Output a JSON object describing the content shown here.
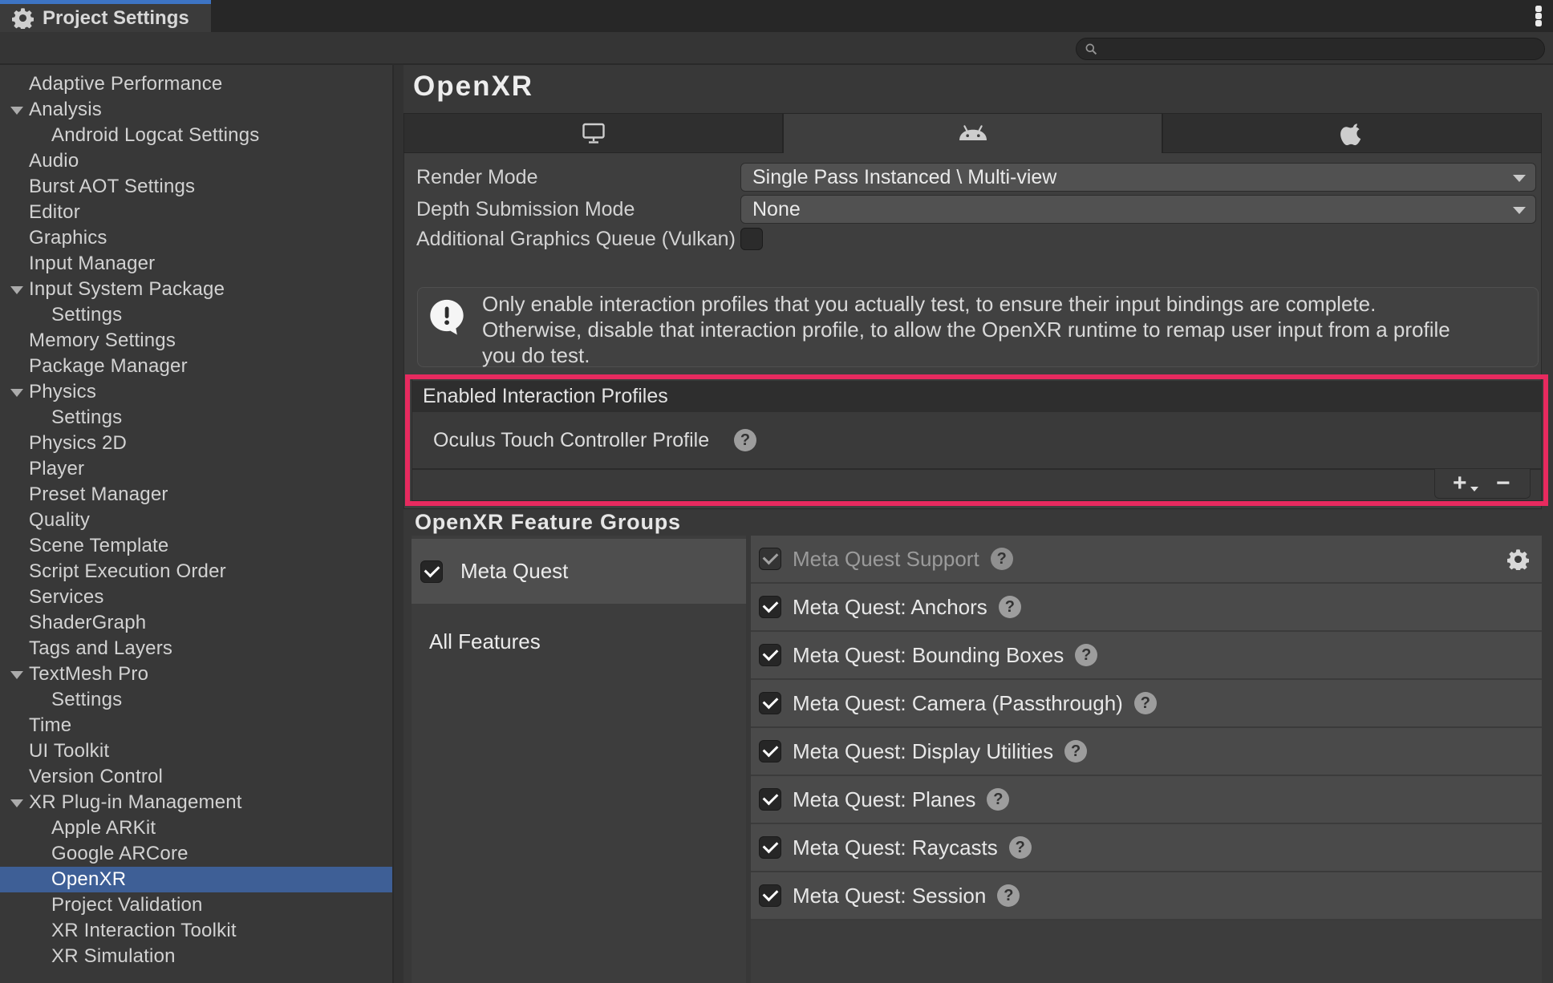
{
  "window": {
    "tab_title": "Project Settings",
    "search_value": ""
  },
  "sidebar": {
    "items": [
      {
        "label": "Adaptive Performance",
        "level": 0,
        "foldout": false,
        "selected": false
      },
      {
        "label": "Analysis",
        "level": 0,
        "foldout": true,
        "selected": false
      },
      {
        "label": "Android Logcat Settings",
        "level": 1,
        "foldout": false,
        "selected": false
      },
      {
        "label": "Audio",
        "level": 0,
        "foldout": false,
        "selected": false
      },
      {
        "label": "Burst AOT Settings",
        "level": 0,
        "foldout": false,
        "selected": false
      },
      {
        "label": "Editor",
        "level": 0,
        "foldout": false,
        "selected": false
      },
      {
        "label": "Graphics",
        "level": 0,
        "foldout": false,
        "selected": false
      },
      {
        "label": "Input Manager",
        "level": 0,
        "foldout": false,
        "selected": false
      },
      {
        "label": "Input System Package",
        "level": 0,
        "foldout": true,
        "selected": false
      },
      {
        "label": "Settings",
        "level": 1,
        "foldout": false,
        "selected": false
      },
      {
        "label": "Memory Settings",
        "level": 0,
        "foldout": false,
        "selected": false
      },
      {
        "label": "Package Manager",
        "level": 0,
        "foldout": false,
        "selected": false
      },
      {
        "label": "Physics",
        "level": 0,
        "foldout": true,
        "selected": false
      },
      {
        "label": "Settings",
        "level": 1,
        "foldout": false,
        "selected": false
      },
      {
        "label": "Physics 2D",
        "level": 0,
        "foldout": false,
        "selected": false
      },
      {
        "label": "Player",
        "level": 0,
        "foldout": false,
        "selected": false
      },
      {
        "label": "Preset Manager",
        "level": 0,
        "foldout": false,
        "selected": false
      },
      {
        "label": "Quality",
        "level": 0,
        "foldout": false,
        "selected": false
      },
      {
        "label": "Scene Template",
        "level": 0,
        "foldout": false,
        "selected": false
      },
      {
        "label": "Script Execution Order",
        "level": 0,
        "foldout": false,
        "selected": false
      },
      {
        "label": "Services",
        "level": 0,
        "foldout": false,
        "selected": false
      },
      {
        "label": "ShaderGraph",
        "level": 0,
        "foldout": false,
        "selected": false
      },
      {
        "label": "Tags and Layers",
        "level": 0,
        "foldout": false,
        "selected": false
      },
      {
        "label": "TextMesh Pro",
        "level": 0,
        "foldout": true,
        "selected": false
      },
      {
        "label": "Settings",
        "level": 1,
        "foldout": false,
        "selected": false
      },
      {
        "label": "Time",
        "level": 0,
        "foldout": false,
        "selected": false
      },
      {
        "label": "UI Toolkit",
        "level": 0,
        "foldout": false,
        "selected": false
      },
      {
        "label": "Version Control",
        "level": 0,
        "foldout": false,
        "selected": false
      },
      {
        "label": "XR Plug-in Management",
        "level": 0,
        "foldout": true,
        "selected": false
      },
      {
        "label": "Apple ARKit",
        "level": 1,
        "foldout": false,
        "selected": false
      },
      {
        "label": "Google ARCore",
        "level": 1,
        "foldout": false,
        "selected": false
      },
      {
        "label": "OpenXR",
        "level": 1,
        "foldout": false,
        "selected": true
      },
      {
        "label": "Project Validation",
        "level": 1,
        "foldout": false,
        "selected": false
      },
      {
        "label": "XR Interaction Toolkit",
        "level": 1,
        "foldout": false,
        "selected": false
      },
      {
        "label": "XR Simulation",
        "level": 1,
        "foldout": false,
        "selected": false
      }
    ]
  },
  "content": {
    "title": "OpenXR",
    "platform_tabs": [
      {
        "icon": "desktop-platform-icon",
        "selected": false
      },
      {
        "icon": "android-platform-icon",
        "selected": true
      },
      {
        "icon": "apple-platform-icon",
        "selected": false
      }
    ],
    "fields": {
      "render_mode": {
        "label": "Render Mode",
        "value": "Single Pass Instanced \\ Multi-view"
      },
      "depth_submission": {
        "label": "Depth Submission Mode",
        "value": "None"
      },
      "vulkan_queue": {
        "label": "Additional Graphics Queue (Vulkan)",
        "checked": false
      }
    },
    "warning": {
      "text": "Only enable interaction profiles that you actually test, to ensure their input bindings are complete. Otherwise, disable that interaction profile, to allow the OpenXR runtime to remap user input from a profile you do test."
    },
    "interaction_profiles": {
      "header": "Enabled Interaction Profiles",
      "items": [
        "Oculus Touch Controller Profile"
      ],
      "add_label": "+",
      "remove_label": "−"
    },
    "feature_groups": {
      "heading": "OpenXR Feature Groups",
      "groups": [
        {
          "label": "Meta Quest",
          "checked": true,
          "selected": true
        },
        {
          "label": "All Features",
          "checked": null,
          "selected": false
        }
      ],
      "features": [
        {
          "label": "Meta Quest Support",
          "checked": true,
          "disabled": true,
          "gear": true
        },
        {
          "label": "Meta Quest: Anchors",
          "checked": true,
          "disabled": false,
          "gear": false
        },
        {
          "label": "Meta Quest: Bounding Boxes",
          "checked": true,
          "disabled": false,
          "gear": false
        },
        {
          "label": "Meta Quest: Camera (Passthrough)",
          "checked": true,
          "disabled": false,
          "gear": false
        },
        {
          "label": "Meta Quest: Display Utilities",
          "checked": true,
          "disabled": false,
          "gear": false
        },
        {
          "label": "Meta Quest: Planes",
          "checked": true,
          "disabled": false,
          "gear": false
        },
        {
          "label": "Meta Quest: Raycasts",
          "checked": true,
          "disabled": false,
          "gear": false
        },
        {
          "label": "Meta Quest: Session",
          "checked": true,
          "disabled": false,
          "gear": false
        }
      ]
    },
    "annotation_color": "#e72a5f"
  }
}
